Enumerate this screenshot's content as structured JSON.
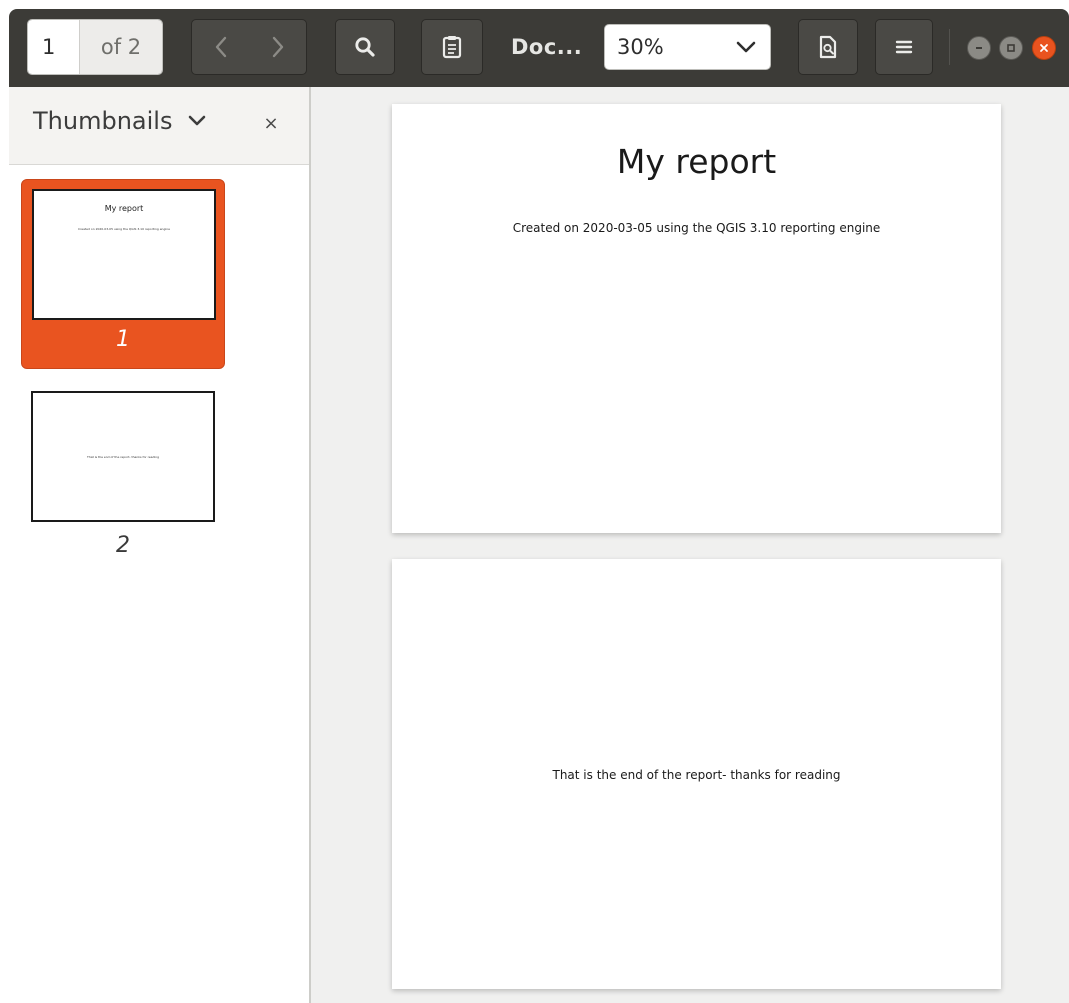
{
  "header": {
    "page_current": "1",
    "page_of": "of 2",
    "title": "Doc...",
    "zoom": "30%"
  },
  "sidebar": {
    "title": "Thumbnails",
    "close": "×",
    "thumbnails": [
      {
        "number": "1",
        "selected": true
      },
      {
        "number": "2",
        "selected": false
      }
    ]
  },
  "document": {
    "pages": [
      {
        "title": "My report",
        "subtitle": "Created on 2020-03-05 using the QGIS 3.10 reporting engine"
      },
      {
        "text": "That is the end of the report- thanks for reading"
      }
    ]
  },
  "colors": {
    "headerbar": "#3c3b37",
    "accent": "#e95420",
    "view_bg": "#f0f0ef"
  },
  "icons": {
    "prev": "chevron-left-icon",
    "next": "chevron-right-icon",
    "search": "search-icon",
    "annotate": "clipboard-icon",
    "zoom_dropdown": "chevron-down-icon",
    "document": "document-icon",
    "menu": "hamburger-menu-icon"
  }
}
